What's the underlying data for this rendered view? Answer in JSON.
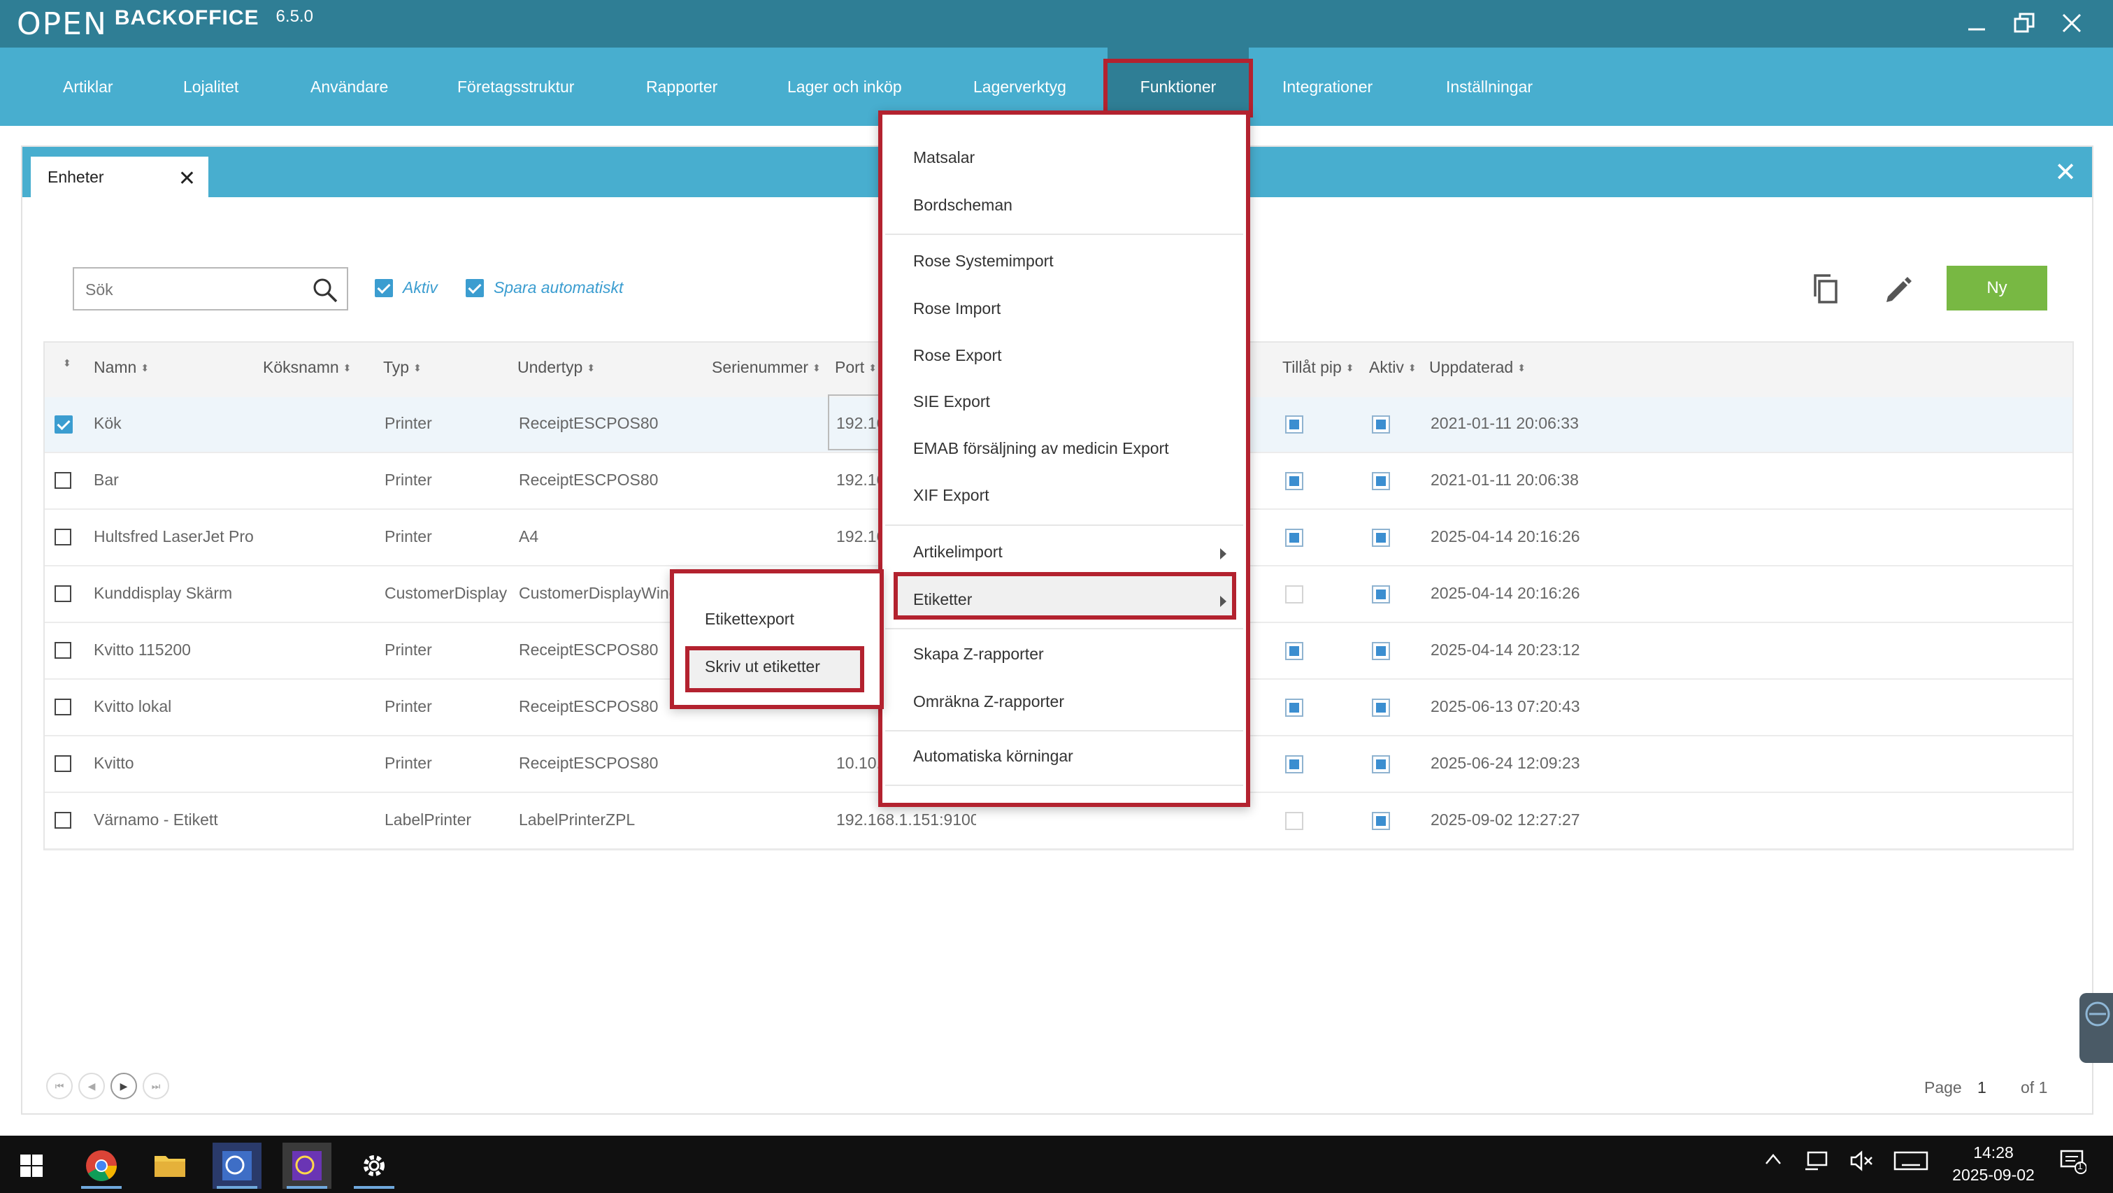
{
  "app": {
    "brand": "BACKOFFICE",
    "version": "6.5.0"
  },
  "nav": [
    {
      "label": "Artiklar"
    },
    {
      "label": "Lojalitet"
    },
    {
      "label": "Användare"
    },
    {
      "label": "Företagsstruktur"
    },
    {
      "label": "Rapporter"
    },
    {
      "label": "Lager och inköp"
    },
    {
      "label": "Lagerverktyg"
    },
    {
      "label": "Funktioner"
    },
    {
      "label": "Integrationer"
    },
    {
      "label": "Inställningar"
    }
  ],
  "tab": {
    "label": "Enheter"
  },
  "toolbar": {
    "search_placeholder": "Sök",
    "filter_aktiv": "Aktiv",
    "filter_spara": "Spara automatiskt",
    "new_label": "Ny"
  },
  "table": {
    "headers": {
      "namn": "Namn",
      "koksnamn": "Köksnamn",
      "typ": "Typ",
      "undertyp": "Undertyp",
      "serienummer": "Serienummer",
      "port": "Port",
      "tillat_pip": "Tillåt pip",
      "aktiv": "Aktiv",
      "uppdaterad": "Uppdaterad"
    },
    "rows": [
      {
        "name": "Kök",
        "type": "Printer",
        "subtype": "ReceiptESCPOS80",
        "port": "192.168.1",
        "pip": true,
        "active": true,
        "updated": "2021-01-11 20:06:33",
        "selected": true
      },
      {
        "name": "Bar",
        "type": "Printer",
        "subtype": "ReceiptESCPOS80",
        "port": "192.168.1",
        "pip": true,
        "active": true,
        "updated": "2021-01-11 20:06:38",
        "selected": false
      },
      {
        "name": "Hultsfred LaserJet Pro",
        "type": "Printer",
        "subtype": "A4",
        "port": "192.168.1",
        "pip": true,
        "active": true,
        "updated": "2025-04-14 20:16:26",
        "selected": false
      },
      {
        "name": "Kunddisplay Skärm",
        "type": "CustomerDisplay",
        "subtype": "CustomerDisplayWindo",
        "port": "",
        "pip": false,
        "active": true,
        "updated": "2025-04-14 20:16:26",
        "selected": false
      },
      {
        "name": "Kvitto 115200",
        "type": "Printer",
        "subtype": "ReceiptESCPOS80",
        "port": "",
        "pip": true,
        "active": true,
        "updated": "2025-04-14 20:23:12",
        "selected": false
      },
      {
        "name": "Kvitto lokal",
        "type": "Printer",
        "subtype": "ReceiptESCPOS80",
        "port": "",
        "pip": true,
        "active": true,
        "updated": "2025-06-13 07:20:43",
        "selected": false
      },
      {
        "name": "Kvitto",
        "type": "Printer",
        "subtype": "ReceiptESCPOS80",
        "port": "10.10.100",
        "pip": true,
        "active": true,
        "updated": "2025-06-24 12:09:23",
        "selected": false
      },
      {
        "name": "Värnamo - Etikett",
        "type": "LabelPrinter",
        "subtype": "LabelPrinterZPL",
        "port": "192.168.1.151:9100",
        "pip": false,
        "active": true,
        "updated": "2025-09-02 12:27:27",
        "selected": false
      }
    ]
  },
  "pager": {
    "page_label": "Page",
    "page": "1",
    "of_label": "of 1"
  },
  "menu": {
    "items": [
      "Matsalar",
      "Bordscheman",
      "Rose Systemimport",
      "Rose Import",
      "Rose Export",
      "SIE Export",
      "EMAB försäljning av medicin Export",
      "XIF Export",
      "Artikelimport",
      "Etiketter",
      "Skapa Z-rapporter",
      "Omräkna Z-rapporter",
      "Automatiska körningar"
    ]
  },
  "submenu": {
    "items": [
      "Etikettexport",
      "Skriv ut etiketter"
    ]
  },
  "taskbar": {
    "time": "14:28",
    "date": "2025-09-02",
    "notif_count": "1"
  },
  "colors": {
    "titlebar": "#2f7e95",
    "nav": "#48aecf",
    "highlight": "#b3222f",
    "new_button": "#78b843",
    "checkbox": "#3b9dd0"
  }
}
